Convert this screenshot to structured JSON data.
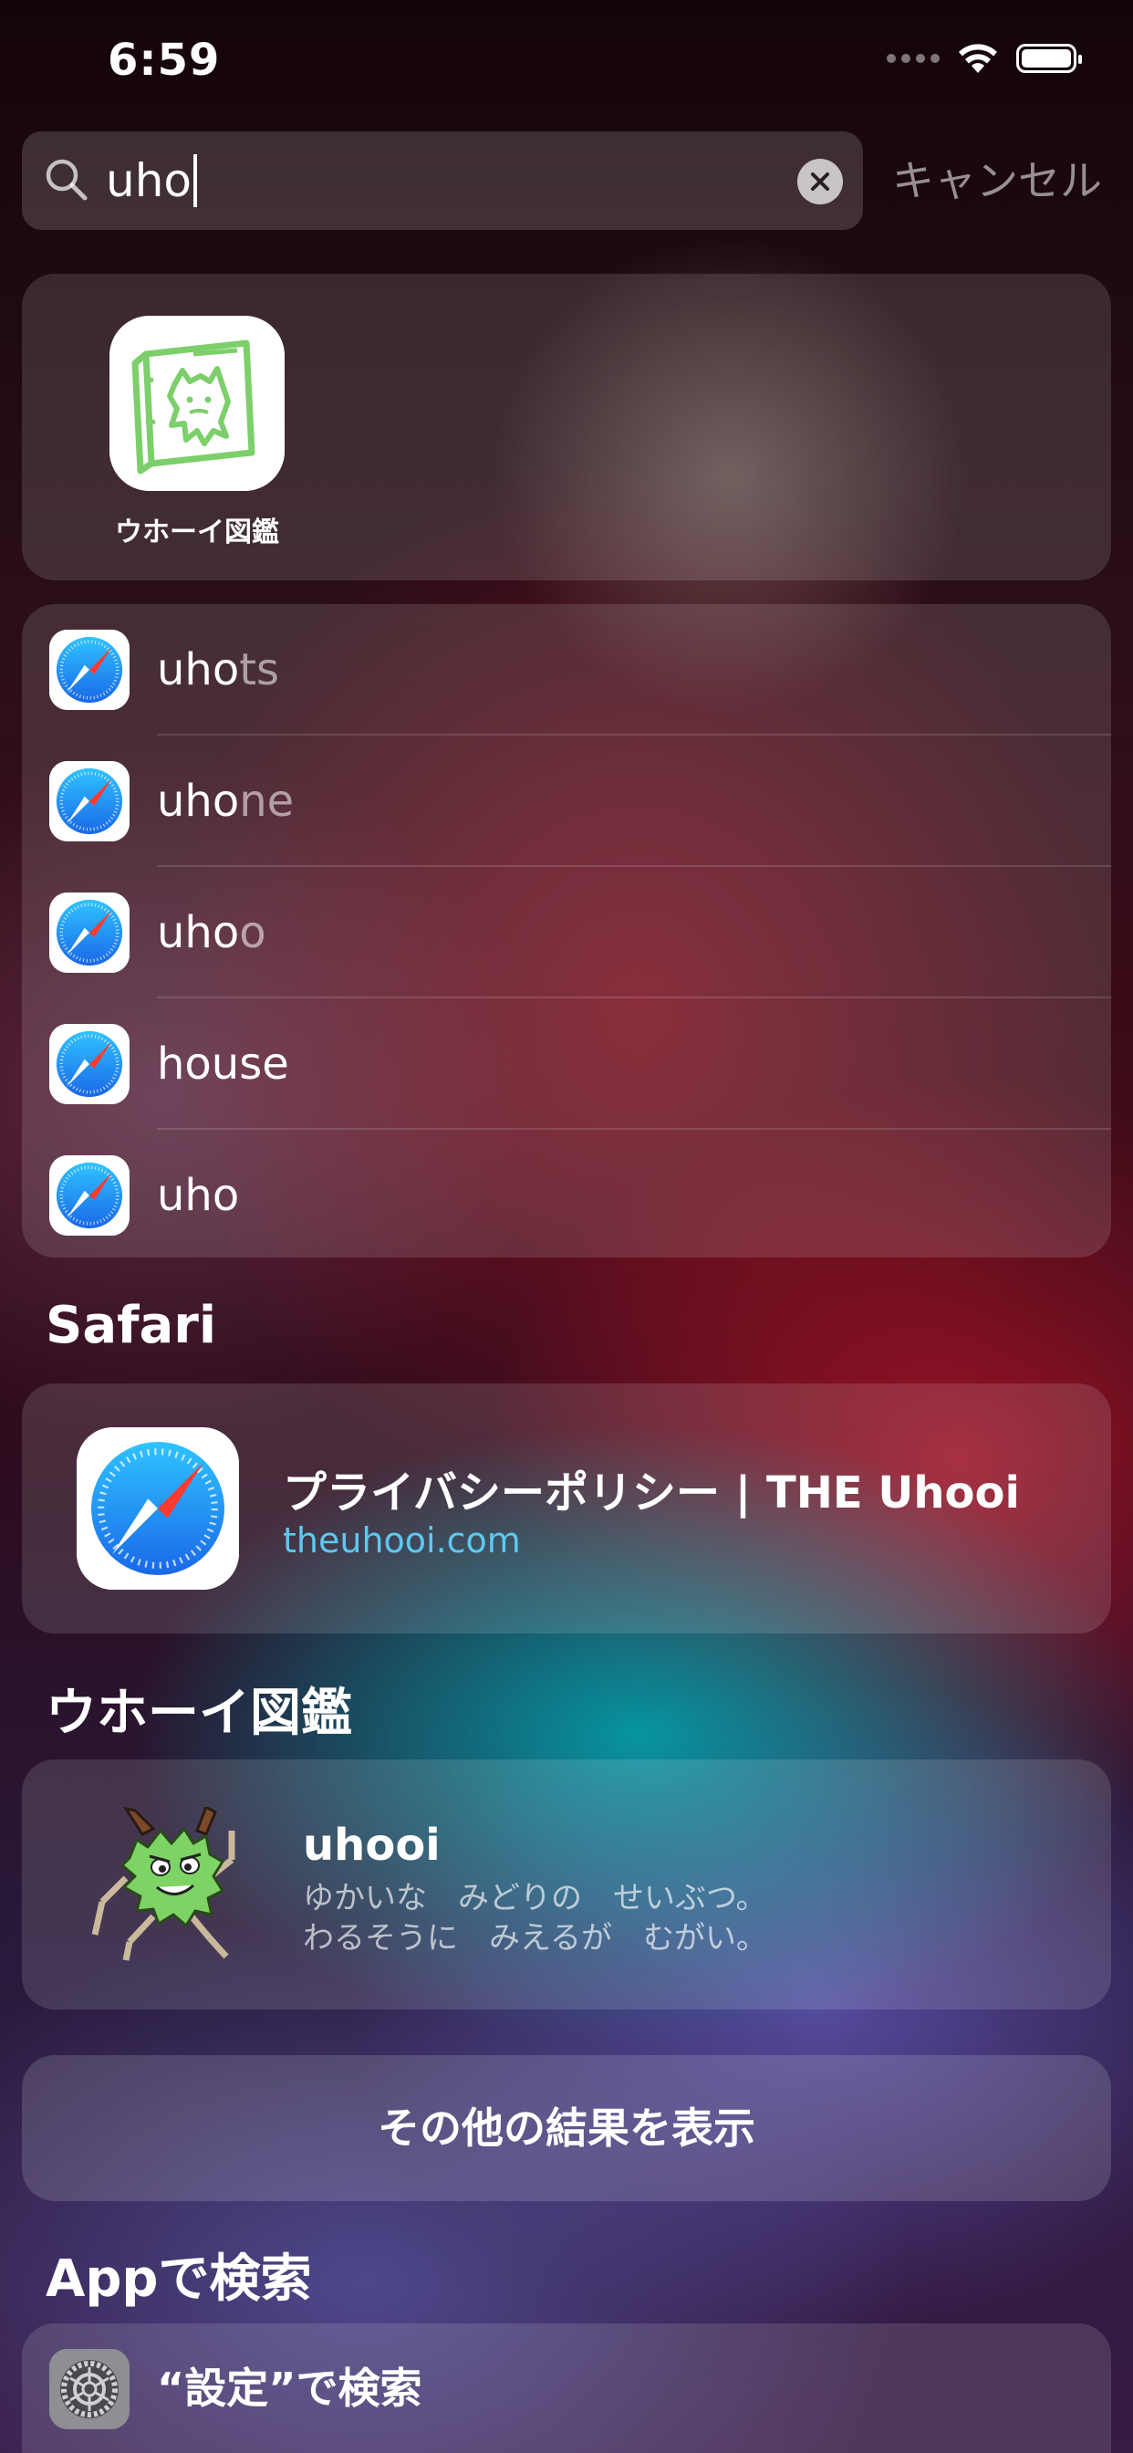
{
  "status_bar": {
    "time": "6:59"
  },
  "search": {
    "query": "uho",
    "cancel_label": "キャンセル"
  },
  "top_hit": {
    "app_name": "ウホーイ図鑑"
  },
  "suggestions": [
    {
      "typed": "uho",
      "completion": "ts",
      "icon": "safari-icon"
    },
    {
      "typed": "uho",
      "completion": "ne",
      "icon": "safari-icon"
    },
    {
      "typed": "uho",
      "completion": "o",
      "icon": "safari-icon"
    },
    {
      "typed": "house",
      "completion": "",
      "icon": "safari-icon"
    },
    {
      "typed": "uho",
      "completion": "",
      "icon": "safari-icon"
    }
  ],
  "safari_section": {
    "header": "Safari",
    "result": {
      "title": "プライバシーポリシー | THE Uhooi",
      "url": "theuhooi.com"
    }
  },
  "app_section": {
    "header": "ウホーイ図鑑",
    "result": {
      "title": "uhooi",
      "line1": "ゆかいな　みどりの　せいぶつ。",
      "line2": "わるそうに　みえるが　むがい。"
    }
  },
  "more_results_label": "その他の結果を表示",
  "search_in_apps": {
    "header": "Appで検索",
    "settings_label": "“設定”で検索"
  },
  "colors": {
    "url_blue": "#5ec8f0",
    "app_icon_green": "#7ccf6a",
    "safari_blue": "#1d8ef0",
    "safari_red": "#ff3b30"
  }
}
